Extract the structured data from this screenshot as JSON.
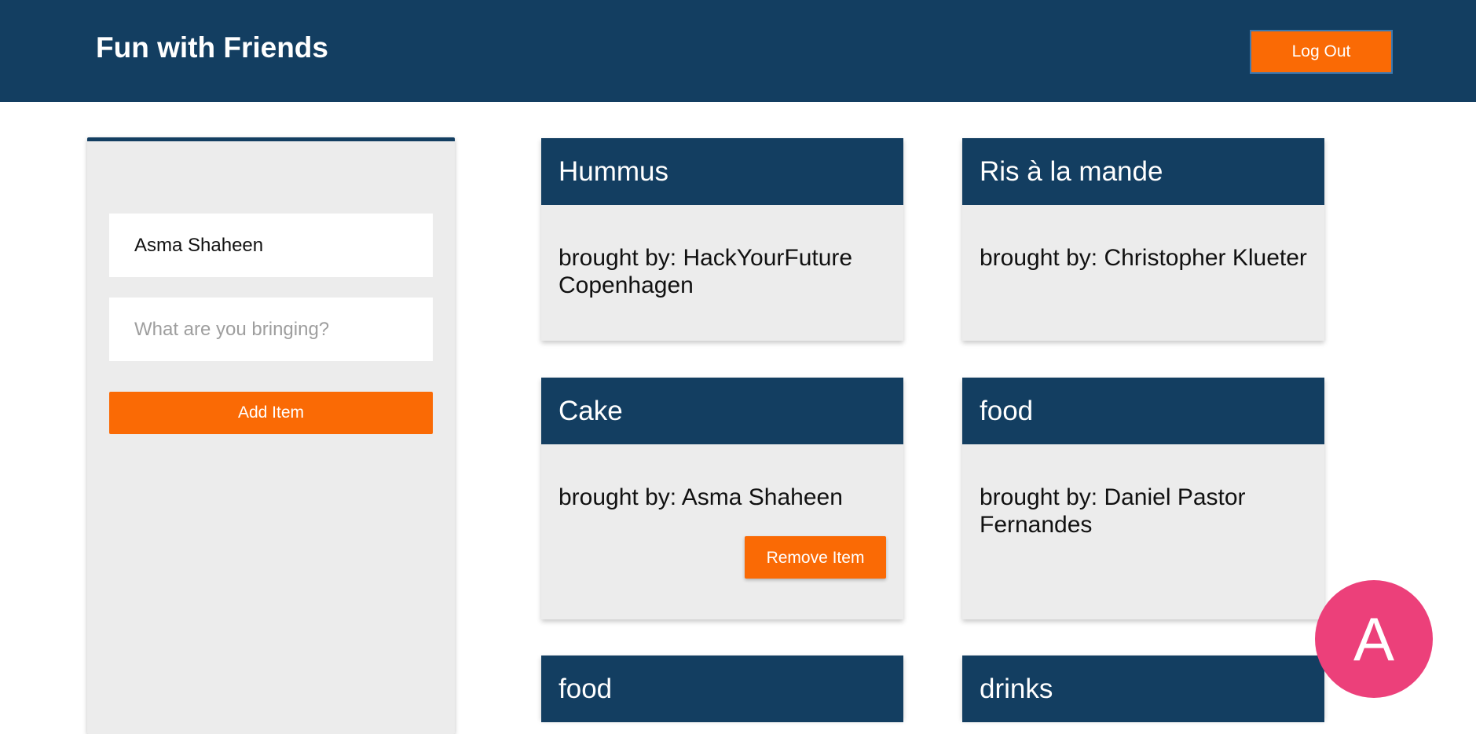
{
  "header": {
    "title": "Fun with Friends",
    "logout_label": "Log Out"
  },
  "form": {
    "name_value": "Asma Shaheen",
    "item_placeholder": "What are you bringing?",
    "add_label": "Add Item"
  },
  "cards": [
    {
      "title": "Hummus",
      "body": "brought by: HackYourFuture Copenhagen"
    },
    {
      "title": "Ris à la mande",
      "body": "brought by: Christopher Klueter"
    },
    {
      "title": "Cake",
      "body": "brought by: Asma Shaheen",
      "remove_label": "Remove Item"
    },
    {
      "title": "food",
      "body": "brought by: Daniel Pastor Fernandes"
    },
    {
      "title": "food",
      "body": ""
    },
    {
      "title": "drinks",
      "body": ""
    }
  ],
  "user": {
    "avatar_letter": "A",
    "avatar_color": "#ec407a"
  },
  "colors": {
    "primary": "#133e61",
    "accent": "#fa6a05"
  }
}
